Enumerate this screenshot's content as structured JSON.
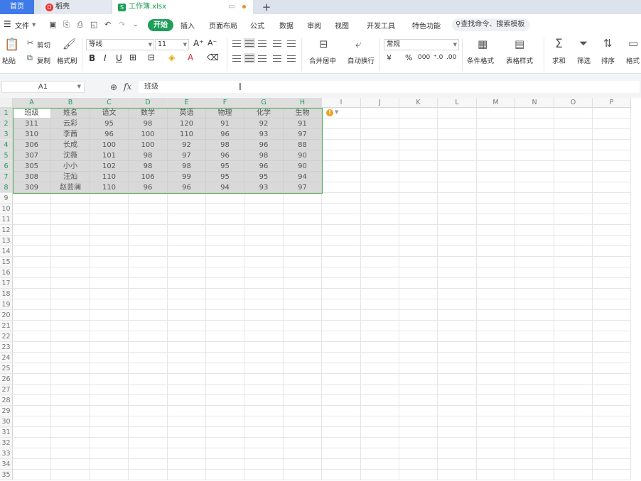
{
  "tabs": {
    "home": "首页",
    "daoke": "稻壳",
    "book": "工作簿.xlsx",
    "add": "+"
  },
  "menu": {
    "file": "文件",
    "start": "开始",
    "items": [
      "插入",
      "页面布局",
      "公式",
      "数据",
      "审阅",
      "视图",
      "开发工具",
      "特色功能"
    ],
    "search": "查找命令、搜索模板"
  },
  "ribbon": {
    "paste": "粘贴",
    "cut": "剪切",
    "copy": "复制",
    "format_painter": "格式刷",
    "font_name": "等线",
    "font_size": "11",
    "merge_center": "合并居中",
    "wrap_text": "自动换行",
    "number_format": "常规",
    "currency": "¥",
    "conditional_format": "条件格式",
    "table_style": "表格样式",
    "sum": "求和",
    "filter": "筛选",
    "sort": "排序",
    "format": "格式"
  },
  "formula_bar": {
    "cell_ref": "A1",
    "fx": "fx",
    "content": "班级"
  },
  "columns": [
    "A",
    "B",
    "C",
    "D",
    "E",
    "F",
    "G",
    "H",
    "I",
    "J",
    "K",
    "L",
    "M",
    "N",
    "O",
    "P"
  ],
  "table": {
    "headers": [
      "班级",
      "姓名",
      "语文",
      "数学",
      "英语",
      "物理",
      "化学",
      "生物"
    ],
    "rows": [
      [
        "311",
        "云彩",
        "95",
        "98",
        "120",
        "91",
        "92",
        "91"
      ],
      [
        "310",
        "李茜",
        "96",
        "100",
        "110",
        "96",
        "93",
        "97"
      ],
      [
        "306",
        "长成",
        "100",
        "100",
        "92",
        "98",
        "96",
        "88"
      ],
      [
        "307",
        "沈薇",
        "101",
        "98",
        "97",
        "96",
        "98",
        "90"
      ],
      [
        "305",
        "小小",
        "102",
        "98",
        "98",
        "95",
        "96",
        "90"
      ],
      [
        "308",
        "汪灿",
        "110",
        "106",
        "99",
        "95",
        "95",
        "94"
      ],
      [
        "309",
        "赵芸澜",
        "110",
        "96",
        "96",
        "94",
        "93",
        "97"
      ]
    ]
  },
  "row_count": 35,
  "colors": {
    "accent": "#1e9e5a",
    "home_tab": "#3f7be8",
    "selection_border": "#4caf50"
  }
}
